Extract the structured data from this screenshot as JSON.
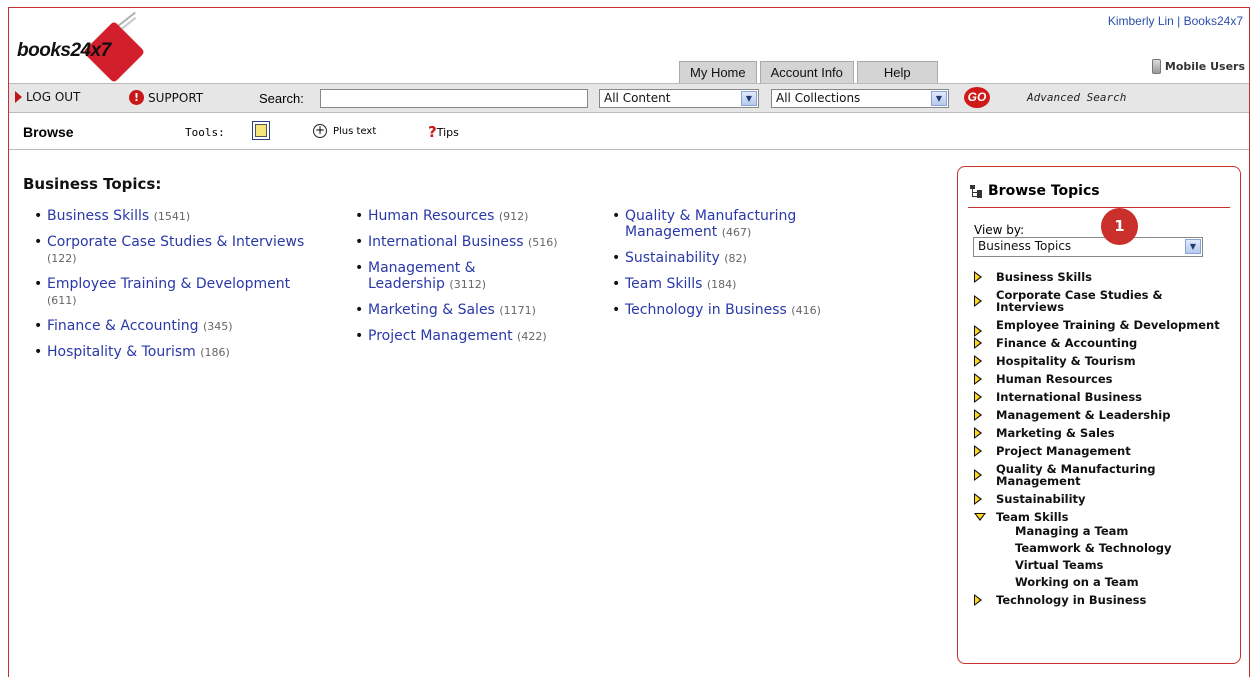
{
  "header": {
    "user_line": "Kimberly Lin | Books24x7",
    "logo_text": "books24x7",
    "tabs": [
      "My Home",
      "Account Info",
      "Help"
    ],
    "mobile_label": "Mobile Users"
  },
  "toolbar": {
    "logout": "LOG OUT",
    "support": "SUPPORT",
    "search_label": "Search:",
    "search_value": "",
    "content_select": "All Content",
    "collections_select": "All Collections",
    "go": "GO",
    "advanced_search": "Advanced Search"
  },
  "browsebar": {
    "title": "Browse",
    "tools_label": "Tools:",
    "plus_text": "Plus text",
    "tips": "Tips"
  },
  "main": {
    "heading": "Business Topics:",
    "columns": [
      [
        {
          "label": "Business Skills",
          "count": "(1541)"
        },
        {
          "label": "Corporate Case Studies & Interviews",
          "count": "(122)"
        },
        {
          "label": "Employee Training & Development",
          "count": "(611)"
        },
        {
          "label": "Finance & Accounting",
          "count": "(345)"
        },
        {
          "label": "Hospitality & Tourism",
          "count": "(186)"
        }
      ],
      [
        {
          "label": "Human Resources",
          "count": "(912)"
        },
        {
          "label": "International Business",
          "count": "(516)"
        },
        {
          "label": "Management & Leadership",
          "count": "(3112)"
        },
        {
          "label": "Marketing & Sales",
          "count": "(1171)"
        },
        {
          "label": "Project Management",
          "count": "(422)"
        }
      ],
      [
        {
          "label": "Quality & Manufacturing Management",
          "count": "(467)"
        },
        {
          "label": "Sustainability",
          "count": "(82)"
        },
        {
          "label": "Team Skills",
          "count": "(184)"
        },
        {
          "label": "Technology in Business",
          "count": "(416)"
        }
      ]
    ]
  },
  "sidebar": {
    "title": "Browse Topics",
    "view_by_label": "View by:",
    "view_by_value": "Business Topics",
    "badge": "1",
    "tree": [
      {
        "label": "Business Skills",
        "expanded": false
      },
      {
        "label": "Corporate Case Studies & Interviews",
        "expanded": false
      },
      {
        "label": "Employee Training & Development",
        "expanded": false
      },
      {
        "label": "Finance & Accounting",
        "expanded": false
      },
      {
        "label": "Hospitality & Tourism",
        "expanded": false
      },
      {
        "label": "Human Resources",
        "expanded": false
      },
      {
        "label": "International Business",
        "expanded": false
      },
      {
        "label": "Management & Leadership",
        "expanded": false
      },
      {
        "label": "Marketing & Sales",
        "expanded": false
      },
      {
        "label": "Project Management",
        "expanded": false
      },
      {
        "label": "Quality & Manufacturing Management",
        "expanded": false
      },
      {
        "label": "Sustainability",
        "expanded": false
      },
      {
        "label": "Team Skills",
        "expanded": true,
        "children": [
          "Managing a Team",
          "Teamwork & Technology",
          "Virtual Teams",
          "Working on a Team"
        ]
      },
      {
        "label": "Technology in Business",
        "expanded": false
      }
    ]
  },
  "colors": {
    "accent_red": "#c9302c",
    "link_blue": "#2a39a8",
    "toolbar_bg": "#e6e6e6"
  }
}
